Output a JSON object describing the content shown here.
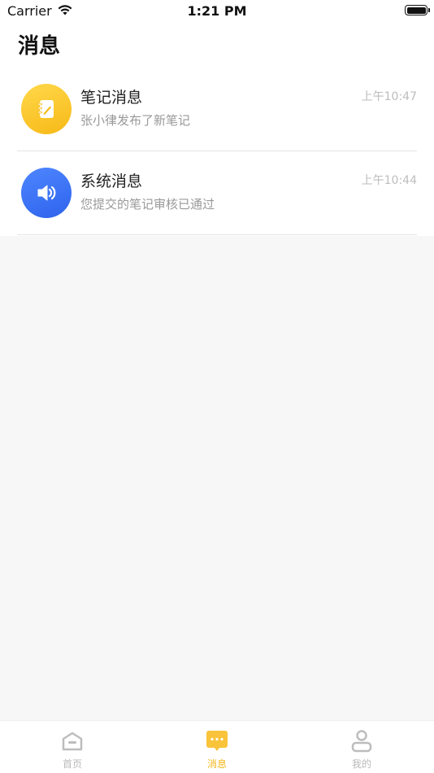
{
  "status_bar": {
    "carrier": "Carrier",
    "time": "1:21 PM",
    "icons": [
      "wifi-icon",
      "battery-icon"
    ]
  },
  "page": {
    "title": "消息"
  },
  "messages": [
    {
      "title": "笔记消息",
      "subtitle": "张小律发布了新笔记",
      "time": "上午10:47",
      "icon": "notebook-icon",
      "color": "#f8c02a"
    },
    {
      "title": "系统消息",
      "subtitle": "您提交的笔记审核已通过",
      "time": "上午10:44",
      "icon": "speaker-icon",
      "color": "#3b72f5"
    }
  ],
  "tab_bar": {
    "tabs": [
      {
        "label": "首页",
        "icon": "home-icon",
        "active": false
      },
      {
        "label": "消息",
        "icon": "message-icon",
        "active": true
      },
      {
        "label": "我的",
        "icon": "profile-icon",
        "active": false
      }
    ],
    "active_color": "#f5b719",
    "inactive_color": "#b9b9b9"
  }
}
